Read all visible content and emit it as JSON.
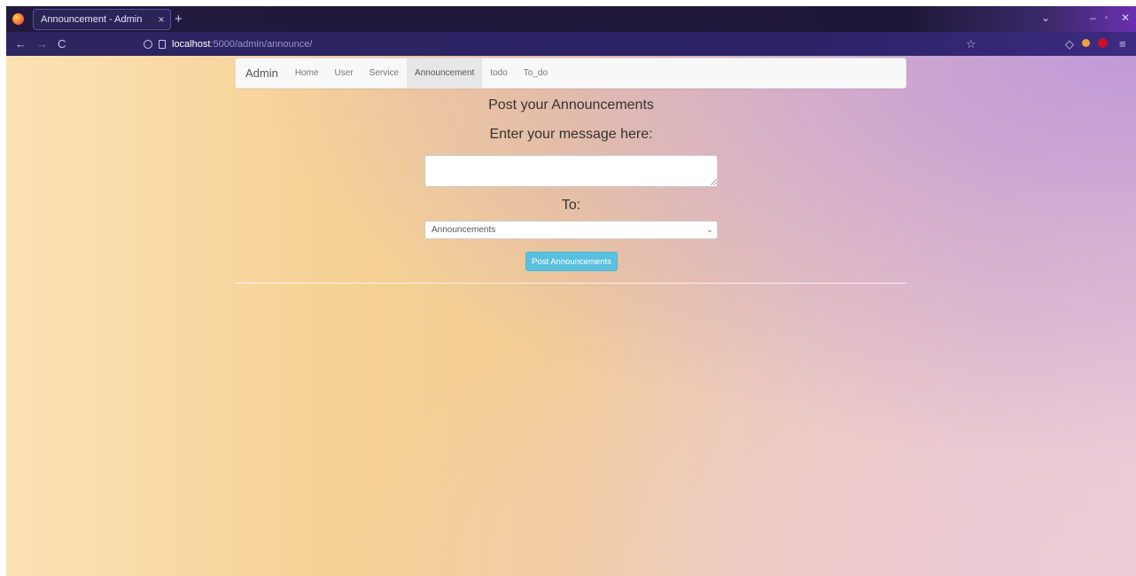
{
  "browser": {
    "tab_title": "Announcement - Admin",
    "tab_close": "×",
    "new_tab": "+",
    "url_host": "localhost",
    "url_rest": ":5000/admin/announce/",
    "icons": {
      "back": "←",
      "forward": "→",
      "reload": "C",
      "bookmark": "☆",
      "pocket": "◇",
      "menu": "≡",
      "tablist": "⌄",
      "minimize": "–",
      "maximize": "▫",
      "close": "✕"
    }
  },
  "nav": {
    "brand": "Admin",
    "items": [
      {
        "label": "Home"
      },
      {
        "label": "User"
      },
      {
        "label": "Service"
      },
      {
        "label": "Announcement",
        "active": true
      },
      {
        "label": "todo"
      },
      {
        "label": "To_do"
      }
    ]
  },
  "form": {
    "title": "Post your Announcements",
    "message_label": "Enter your message here:",
    "message_value": "",
    "to_label": "To:",
    "to_selected": "Announcements",
    "submit_label": "Post Announcements"
  },
  "colors": {
    "button": "#5bc0de",
    "tab_bg": "#2b2456",
    "toolbar": "#2d2460"
  }
}
